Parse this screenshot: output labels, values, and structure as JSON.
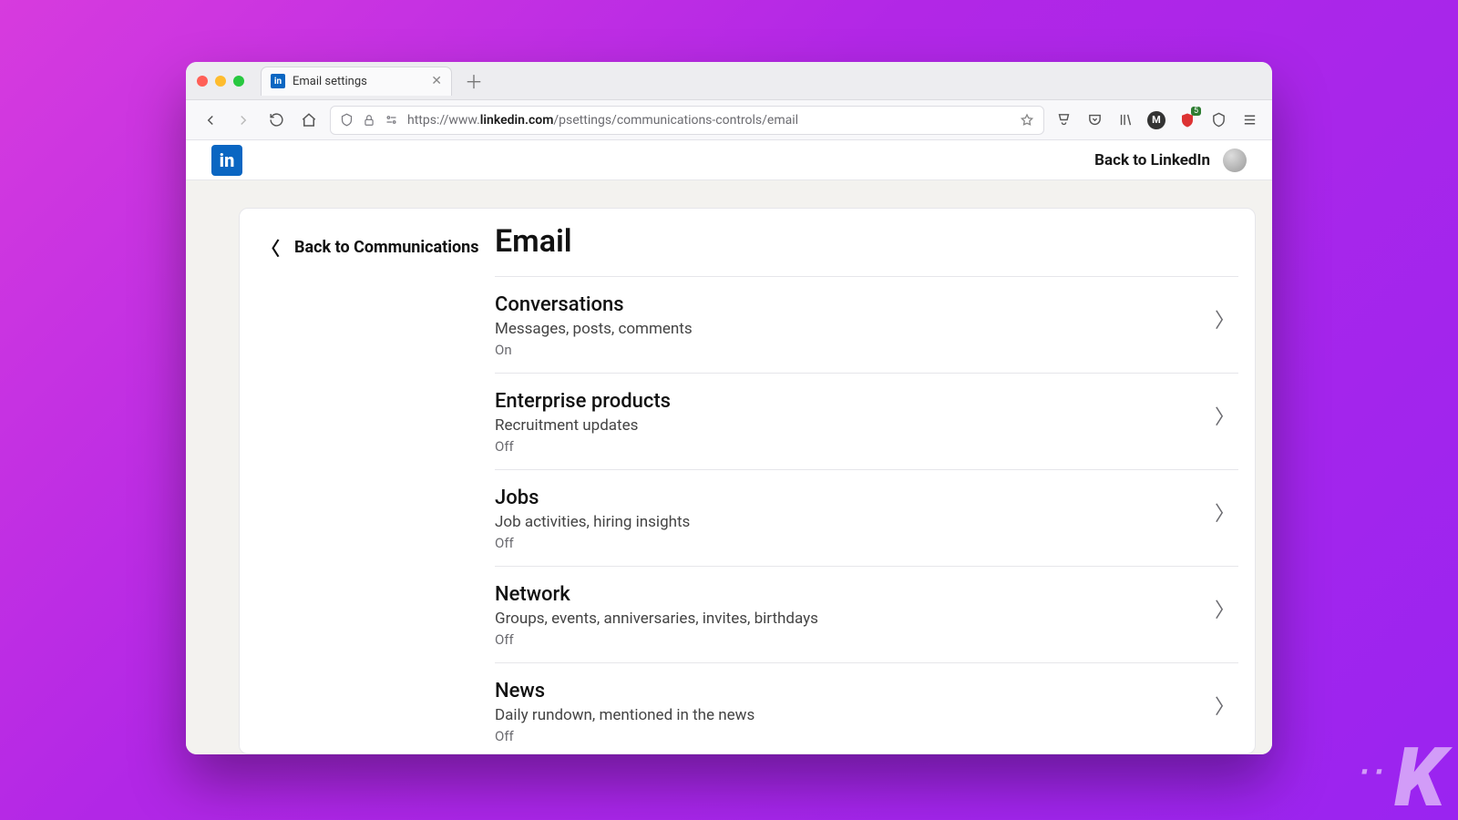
{
  "browser": {
    "tab": {
      "title": "Email settings",
      "favicon": "in"
    },
    "url": {
      "scheme": "https://www.",
      "host": "linkedin.com",
      "path": "/psettings/communications-controls/email"
    },
    "right_badge_count": "5"
  },
  "header": {
    "logo_text": "in",
    "back_label": "Back to LinkedIn"
  },
  "sidebar": {
    "back_label": "Back to Communications"
  },
  "page": {
    "title": "Email",
    "sections": [
      {
        "title": "Conversations",
        "desc": "Messages, posts, comments",
        "state": "On"
      },
      {
        "title": "Enterprise products",
        "desc": "Recruitment updates",
        "state": "Off"
      },
      {
        "title": "Jobs",
        "desc": "Job activities, hiring insights",
        "state": "Off"
      },
      {
        "title": "Network",
        "desc": "Groups, events, anniversaries, invites, birthdays",
        "state": "Off"
      },
      {
        "title": "News",
        "desc": "Daily rundown, mentioned in the news",
        "state": "Off"
      }
    ]
  }
}
